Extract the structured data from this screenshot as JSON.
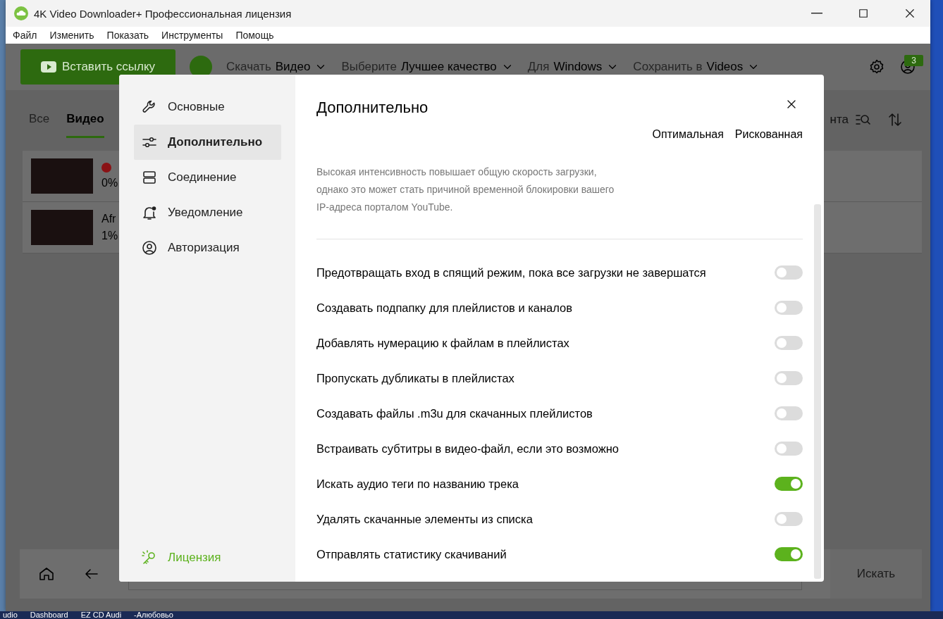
{
  "window": {
    "title": "4K Video Downloader+ Профессиональная лицензия"
  },
  "menu": [
    "Файл",
    "Изменить",
    "Показать",
    "Инструменты",
    "Помощь"
  ],
  "toolbar": {
    "paste_button": "Вставить ссылку",
    "download_label": "Скачать",
    "download_value": "Видео",
    "choose_label": "Выберите",
    "choose_value": "Лучшее качество",
    "for_label": "Для",
    "for_value": "Windows",
    "save_label": "Сохранить в",
    "save_value": "Videos",
    "badge": "3"
  },
  "tabs": [
    {
      "label": "Все",
      "selected": false
    },
    {
      "label": "Видео",
      "selected": true
    }
  ],
  "list_header_text": "нта",
  "downloads": [
    {
      "kind": "error",
      "progress": "0%"
    },
    {
      "kind": "named",
      "title": "Afr",
      "progress": "1%"
    }
  ],
  "search_button": "Искать",
  "taskbar": [
    "udio",
    "Dashboard",
    "EZ CD Audi",
    "-Алюбовьо"
  ],
  "dialog": {
    "sidebar": [
      {
        "label": "Основные",
        "selected": false
      },
      {
        "label": "Дополнительно",
        "selected": true
      },
      {
        "label": "Соединение",
        "selected": false
      },
      {
        "label": "Уведомление",
        "selected": false
      },
      {
        "label": "Авторизация",
        "selected": false
      }
    ],
    "license": "Лицензия",
    "title": "Дополнительно",
    "intensity_options": [
      "Оптимальная",
      "Рискованная"
    ],
    "description": "Высокая интенсивность повышает общую скорость загрузки, однако это может стать причиной временной блокировки вашего IP-адреса порталом YouTube.",
    "options": [
      {
        "label": "Предотвращать вход в спящий режим, пока все загрузки не завершатся",
        "on": false
      },
      {
        "label": "Создавать подпапку для плейлистов и каналов",
        "on": false
      },
      {
        "label": "Добавлять нумерацию к файлам в плейлистах",
        "on": false
      },
      {
        "label": "Пропускать дубликаты в плейлистах",
        "on": false
      },
      {
        "label": "Создавать файлы .m3u для скачанных плейлистов",
        "on": false
      },
      {
        "label": "Встраивать субтитры в видео-файл, если это возможно",
        "on": false
      },
      {
        "label": "Искать аудио теги по названию трека",
        "on": true
      },
      {
        "label": "Удалять скачанные элементы из списка",
        "on": false
      },
      {
        "label": "Отправлять статистику скачиваний",
        "on": true
      }
    ]
  }
}
